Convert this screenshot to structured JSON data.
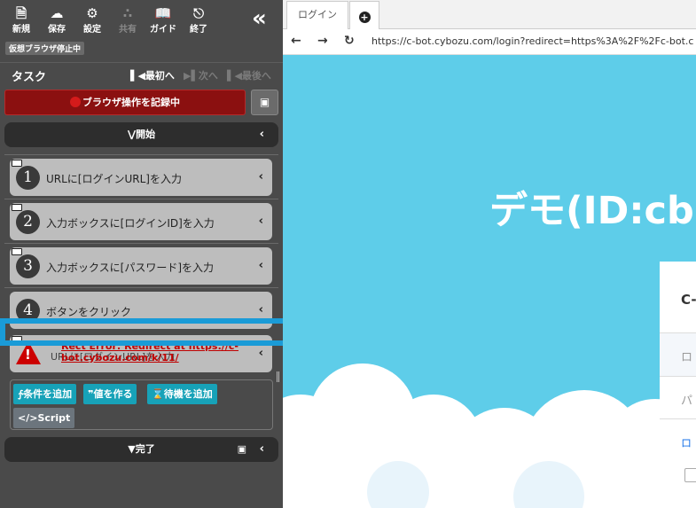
{
  "toolbar": {
    "new_label": "新規",
    "save_label": "保存",
    "settings_label": "設定",
    "share_label": "共有",
    "guide_label": "ガイド",
    "exit_label": "終了",
    "collapse": "«",
    "status_badge": "仮想ブラウザ停止中"
  },
  "task": {
    "title": "タスク",
    "first": "最初へ",
    "next": "次へ",
    "last": "最後へ"
  },
  "record_label": "ブラウザ操作を記録中",
  "start_band": "開始",
  "steps": [
    {
      "num": "1",
      "label": "URLに[ログインURL]を入力"
    },
    {
      "num": "2",
      "label": "入力ボックスに[ログインID]を入力"
    },
    {
      "num": "3",
      "label": "入力ボックスに[パスワード]を入力"
    },
    {
      "num": "4",
      "label": "ボタンをクリック"
    }
  ],
  "error_step": {
    "error_text_line1": "Rect Error: Redirect at https://c-",
    "error_text_line2": "bot.cybozu.com/k/11/",
    "label": "URLに[ログインURL]を入力"
  },
  "actions": {
    "add_condition": "条件を追加",
    "make_value": "値を作る",
    "add_wait": "待機を追加",
    "script": "Script"
  },
  "done_band": "完了",
  "browser": {
    "tab_label": "ログイン",
    "url": "https://c-bot.cybozu.com/login?redirect=https%3A%2F%2Fc-bot.c",
    "hero_title": "デモ(ID:cb",
    "card_title": "C-",
    "field1_placeholder": "ロ",
    "field2_placeholder": "パ",
    "link_text": "ロ"
  }
}
